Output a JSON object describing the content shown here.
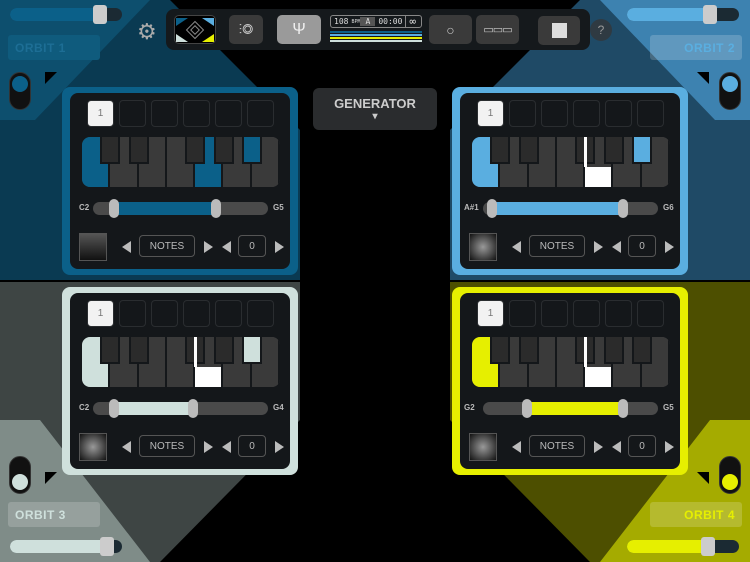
{
  "toolbar": {
    "bpm": "108",
    "bpm_unit": "BPM",
    "key": "A",
    "time": "00:00",
    "loop": "∞",
    "icons": [
      "orbit-logo-icon",
      "mixer-icon",
      "tuning-fork-icon",
      "drum-icon",
      "grid-icon",
      "stop-icon",
      "help-icon",
      "gear-icon"
    ],
    "help": "?"
  },
  "generator": {
    "label": "GENERATOR",
    "arrow": "▾"
  },
  "orbits": [
    {
      "name": "ORBIT 1",
      "color": "#0b6089",
      "bg": "#0a3a52",
      "corner": "#0d4f6e",
      "volume": 0.8,
      "toggle_on": true,
      "slot": "1",
      "range_low": "C2",
      "range_high": "G5",
      "range": [
        0.12,
        0.7
      ],
      "mode": "NOTES",
      "value": "0",
      "keys": [
        "C",
        "G",
        "A#"
      ]
    },
    {
      "name": "ORBIT 2",
      "color": "#5aaee0",
      "bg": "#1f4a66",
      "corner": "#3d82b0",
      "volume": 0.74,
      "toggle_on": true,
      "slot": "1",
      "range_low": "A#1",
      "range_high": "G6",
      "range": [
        0.05,
        0.8
      ],
      "mode": "NOTES",
      "value": "0",
      "keys": [
        "C",
        "A#"
      ],
      "playing": [
        "G"
      ]
    },
    {
      "name": "ORBIT 3",
      "color": "#cfe0dc",
      "bg": "#4a5250",
      "corner": "#7f8c88",
      "volume": 0.87,
      "toggle_on": true,
      "slot": "1",
      "range_low": "C2",
      "range_high": "G4",
      "range": [
        0.12,
        0.57
      ],
      "mode": "NOTES",
      "value": "0",
      "keys": [
        "C",
        "A#"
      ],
      "playing": [
        "G"
      ]
    },
    {
      "name": "ORBIT 4",
      "color": "#e6ef00",
      "bg": "#5a5c00",
      "corner": "#a5ab00",
      "volume": 0.72,
      "toggle_on": true,
      "slot": "1",
      "range_low": "G2",
      "range_high": "G5",
      "range": [
        0.25,
        0.8
      ],
      "mode": "NOTES",
      "value": "0",
      "keys": [
        "C"
      ],
      "playing": [
        "G"
      ]
    }
  ]
}
